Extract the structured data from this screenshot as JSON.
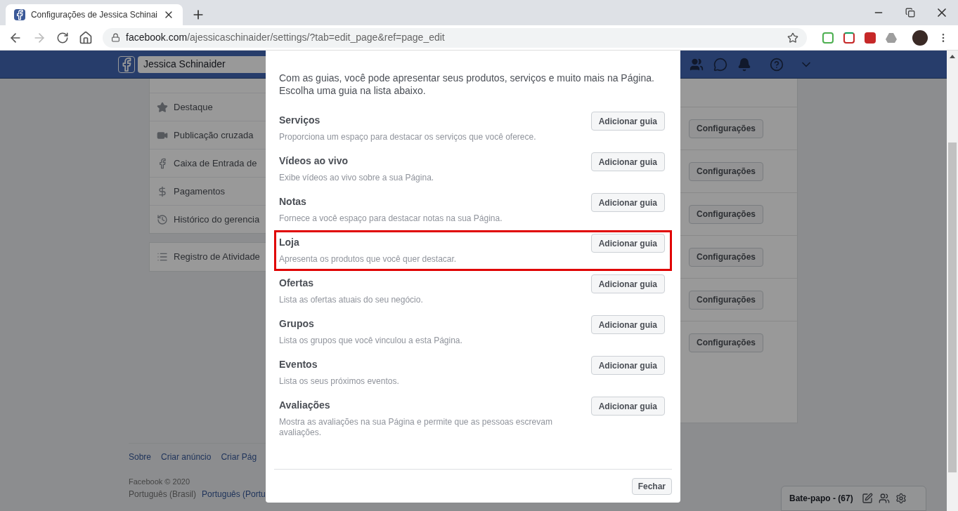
{
  "browser": {
    "tab_title": "Configurações de Jessica Schinai",
    "url_host": "facebook.com",
    "url_path": "/ajessicaschinaider/settings/?tab=edit_page&ref=page_edit"
  },
  "header": {
    "search_value": "Jessica Schinaider"
  },
  "sidebar": {
    "items": [
      {
        "label": "Destaque"
      },
      {
        "label": "Publicação cruzada"
      },
      {
        "label": "Caixa de Entrada de"
      },
      {
        "label": "Pagamentos"
      },
      {
        "label": "Histórico do gerencia"
      }
    ],
    "activity": {
      "label": "Registro de Atividade"
    }
  },
  "settings_buttons": [
    "Configurações",
    "Configurações",
    "Configurações",
    "Configurações",
    "Configurações",
    "Configurações"
  ],
  "footer": {
    "links": [
      "Sobre",
      "Criar anúncio",
      "Criar Pág"
    ],
    "copyright": "Facebook © 2020",
    "current_language": "Português (Brasil)",
    "other_language": "Português (Portu"
  },
  "chat": {
    "label": "Bate-papo - (67)"
  },
  "modal": {
    "intro": "Com as guias, você pode apresentar seus produtos, serviços e muito mais na Página. Escolha uma guia na lista abaixo.",
    "tabs": [
      {
        "title": "Serviços",
        "description": "Proporciona um espaço para destacar os serviços que você oferece.",
        "button": "Adicionar guia",
        "highlighted": false
      },
      {
        "title": "Vídeos ao vivo",
        "description": "Exibe vídeos ao vivo sobre a sua Página.",
        "button": "Adicionar guia",
        "highlighted": false
      },
      {
        "title": "Notas",
        "description": "Fornece a você espaço para destacar notas na sua Página.",
        "button": "Adicionar guia",
        "highlighted": false
      },
      {
        "title": "Loja",
        "description": "Apresenta os produtos que você quer destacar.",
        "button": "Adicionar guia",
        "highlighted": true
      },
      {
        "title": "Ofertas",
        "description": "Lista as ofertas atuais do seu negócio.",
        "button": "Adicionar guia",
        "highlighted": false
      },
      {
        "title": "Grupos",
        "description": "Lista os grupos que você vinculou a esta Página.",
        "button": "Adicionar guia",
        "highlighted": false
      },
      {
        "title": "Eventos",
        "description": "Lista os seus próximos eventos.",
        "button": "Adicionar guia",
        "highlighted": false
      },
      {
        "title": "Avaliações",
        "description": "Mostra as avaliações na sua Página e permite que as pessoas escrevam avaliações.",
        "button": "Adicionar guia",
        "highlighted": false
      }
    ],
    "close_button": "Fechar"
  }
}
